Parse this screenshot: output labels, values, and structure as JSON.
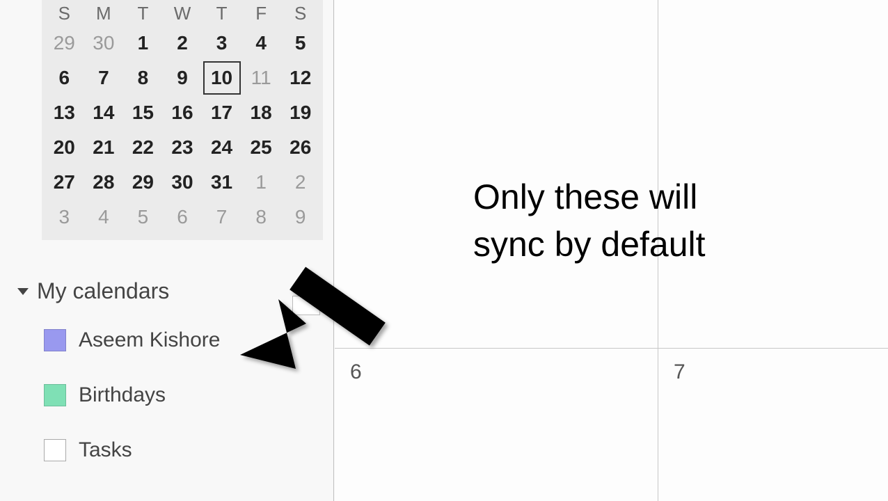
{
  "mini_calendar": {
    "weekdays": [
      "S",
      "M",
      "T",
      "W",
      "T",
      "F",
      "S"
    ],
    "weeks": [
      [
        {
          "d": "29",
          "other": true
        },
        {
          "d": "30",
          "other": true
        },
        {
          "d": "1"
        },
        {
          "d": "2"
        },
        {
          "d": "3"
        },
        {
          "d": "4"
        },
        {
          "d": "5"
        }
      ],
      [
        {
          "d": "6"
        },
        {
          "d": "7"
        },
        {
          "d": "8"
        },
        {
          "d": "9"
        },
        {
          "d": "10",
          "today": true
        },
        {
          "d": "11",
          "other": true
        },
        {
          "d": "12"
        }
      ],
      [
        {
          "d": "13"
        },
        {
          "d": "14"
        },
        {
          "d": "15"
        },
        {
          "d": "16"
        },
        {
          "d": "17"
        },
        {
          "d": "18"
        },
        {
          "d": "19"
        }
      ],
      [
        {
          "d": "20"
        },
        {
          "d": "21"
        },
        {
          "d": "22"
        },
        {
          "d": "23"
        },
        {
          "d": "24"
        },
        {
          "d": "25"
        },
        {
          "d": "26"
        }
      ],
      [
        {
          "d": "27"
        },
        {
          "d": "28"
        },
        {
          "d": "29"
        },
        {
          "d": "30"
        },
        {
          "d": "31"
        },
        {
          "d": "1",
          "other": true
        },
        {
          "d": "2",
          "other": true
        }
      ],
      [
        {
          "d": "3",
          "other": true
        },
        {
          "d": "4",
          "other": true
        },
        {
          "d": "5",
          "other": true
        },
        {
          "d": "6",
          "other": true
        },
        {
          "d": "7",
          "other": true
        },
        {
          "d": "8",
          "other": true
        },
        {
          "d": "9",
          "other": true
        }
      ]
    ]
  },
  "sidebar": {
    "section_title": "My calendars",
    "calendars": [
      {
        "name": "Aseem Kishore",
        "color": "#9999ef"
      },
      {
        "name": "Birthdays",
        "color": "#7fe0b5"
      },
      {
        "name": "Tasks",
        "color": "#ffffff"
      }
    ]
  },
  "main_grid": {
    "day_labels": [
      "6",
      "7"
    ]
  },
  "annotation": {
    "text": "Only these will\nsync by default"
  }
}
